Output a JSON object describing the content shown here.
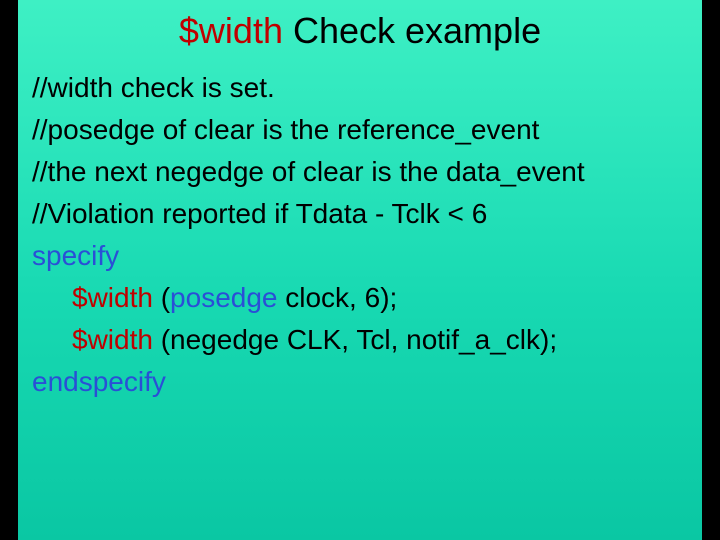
{
  "title": {
    "kw": "$width",
    "rest": " Check example"
  },
  "lines": {
    "c1": "//width check is set.",
    "c2": "//posedge of clear is the reference_event",
    "c3": "//the next negedge of clear is the data_event",
    "c4": "//Violation reported if Tdata - Tclk < 6",
    "specify": "specify",
    "l1_kw": "$width",
    "l1_open": " (",
    "l1_posedge": "posedge",
    "l1_rest": " clock, 6);",
    "l2_kw": "$width",
    "l2_rest": " (negedge CLK, Tcl, notif_a_clk);",
    "endspecify": "endspecify"
  }
}
